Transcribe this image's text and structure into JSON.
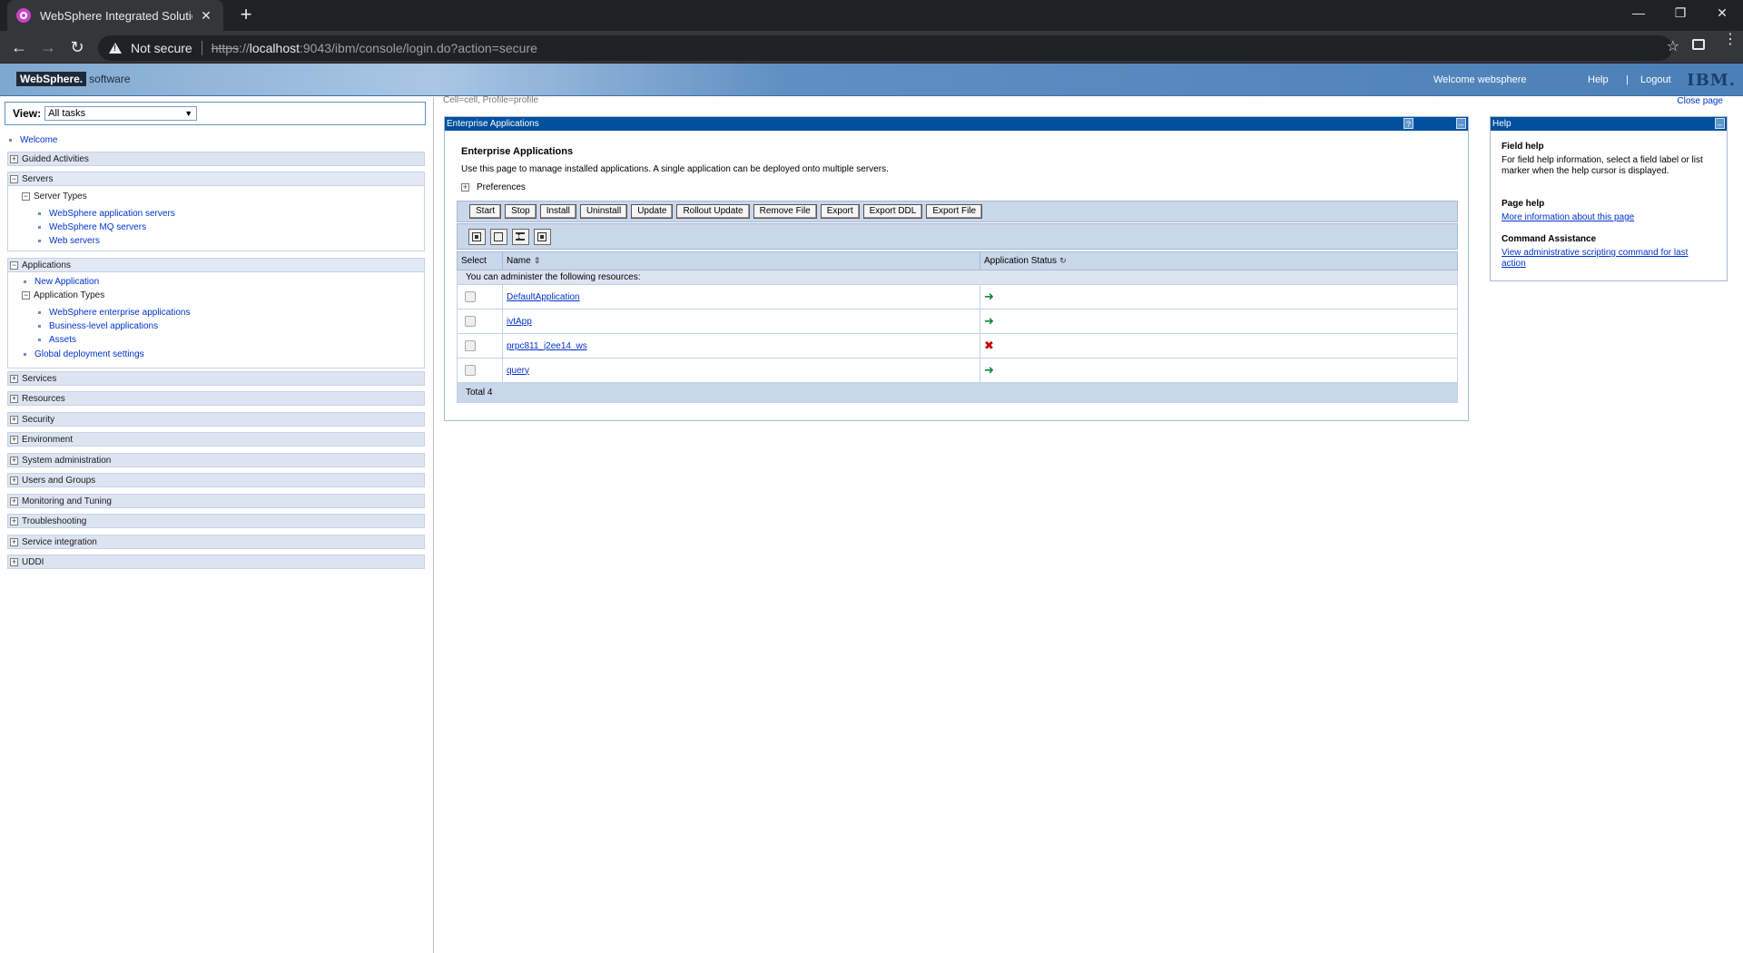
{
  "browser": {
    "tab_title": "WebSphere Integrated Solutions",
    "close_tab_glyph": "✕",
    "new_tab_glyph": "+",
    "security_label": "Not secure",
    "url_scheme": "https",
    "url_sep": "://",
    "url_host": "localhost",
    "url_rest": ":9043/ibm/console/login.do?action=secure",
    "minimize_glyph": "—",
    "restore_glyph": "❐",
    "close_glyph": "✕",
    "back_glyph": "←",
    "forward_glyph": "→",
    "reload_glyph": "↻",
    "star_glyph": "☆",
    "menu_glyph": "⋮"
  },
  "banner": {
    "brand": "WebSphere.",
    "brand_suffix": "software",
    "welcome": "Welcome websphere",
    "help": "Help",
    "divider": "|",
    "logout": "Logout",
    "ibm": "IBM."
  },
  "nav": {
    "view_label": "View:",
    "view_value": "All tasks",
    "welcome": "Welcome",
    "guided_activities": "Guided Activities",
    "servers": "Servers",
    "server_types": "Server Types",
    "server_links": [
      "WebSphere application servers",
      "WebSphere MQ servers",
      "Web servers"
    ],
    "applications": "Applications",
    "new_application": "New Application",
    "application_types": "Application Types",
    "app_links": [
      "WebSphere enterprise applications",
      "Business-level applications",
      "Assets"
    ],
    "global_deployment": "Global deployment settings",
    "sections": [
      "Services",
      "Resources",
      "Security",
      "Environment",
      "System administration",
      "Users and Groups",
      "Monitoring and Tuning",
      "Troubleshooting",
      "Service integration",
      "UDDI"
    ],
    "plus": "+",
    "minus": "−"
  },
  "main": {
    "cell_profile": "Cell=cell, Profile=profile",
    "close_page": "Close page",
    "panel_title": "Enterprise Applications",
    "help_q": "?",
    "minimize": "–",
    "heading": "Enterprise Applications",
    "description": "Use this page to manage installed applications. A single application can be deployed onto multiple servers.",
    "preferences": "Preferences",
    "buttons": [
      "Start",
      "Stop",
      "Install",
      "Uninstall",
      "Update",
      "Rollout Update",
      "Remove File",
      "Export",
      "Export DDL",
      "Export File"
    ],
    "columns": {
      "select": "Select",
      "name": "Name",
      "status": "Application Status"
    },
    "info_row": "You can administer the following resources:",
    "applications": [
      {
        "name": "DefaultApplication",
        "status": "started",
        "glyph": "➜"
      },
      {
        "name": "ivtApp",
        "status": "started",
        "glyph": "➜"
      },
      {
        "name": "prpc811_j2ee14_ws",
        "status": "stopped",
        "glyph": "✖"
      },
      {
        "name": "query",
        "status": "started",
        "glyph": "➜"
      }
    ],
    "total": "Total 4",
    "sort_glyph": "⇕",
    "refresh_glyph": "↻"
  },
  "help": {
    "title": "Help",
    "minimize": "–",
    "field_help_title": "Field help",
    "field_help_text": "For field help information, select a field label or list marker when the help cursor is displayed.",
    "page_help_title": "Page help",
    "page_help_link": "More information about this page",
    "command_title": "Command Assistance",
    "command_link": "View administrative scripting command for last action"
  },
  "colors": {
    "header_blue": "#00509e",
    "link_blue": "#0033cc",
    "running_green": "#0a8a3a",
    "stopped_red": "#cc0000"
  },
  "icons": {
    "favicon": "websphere-favicon-icon",
    "warning": "warning-triangle-icon",
    "extension": "extension-icon",
    "select_all": "select-all-icon",
    "deselect_all": "deselect-all-icon",
    "expand_collapse": "expand-collapse-icon",
    "filter": "filter-icon"
  }
}
